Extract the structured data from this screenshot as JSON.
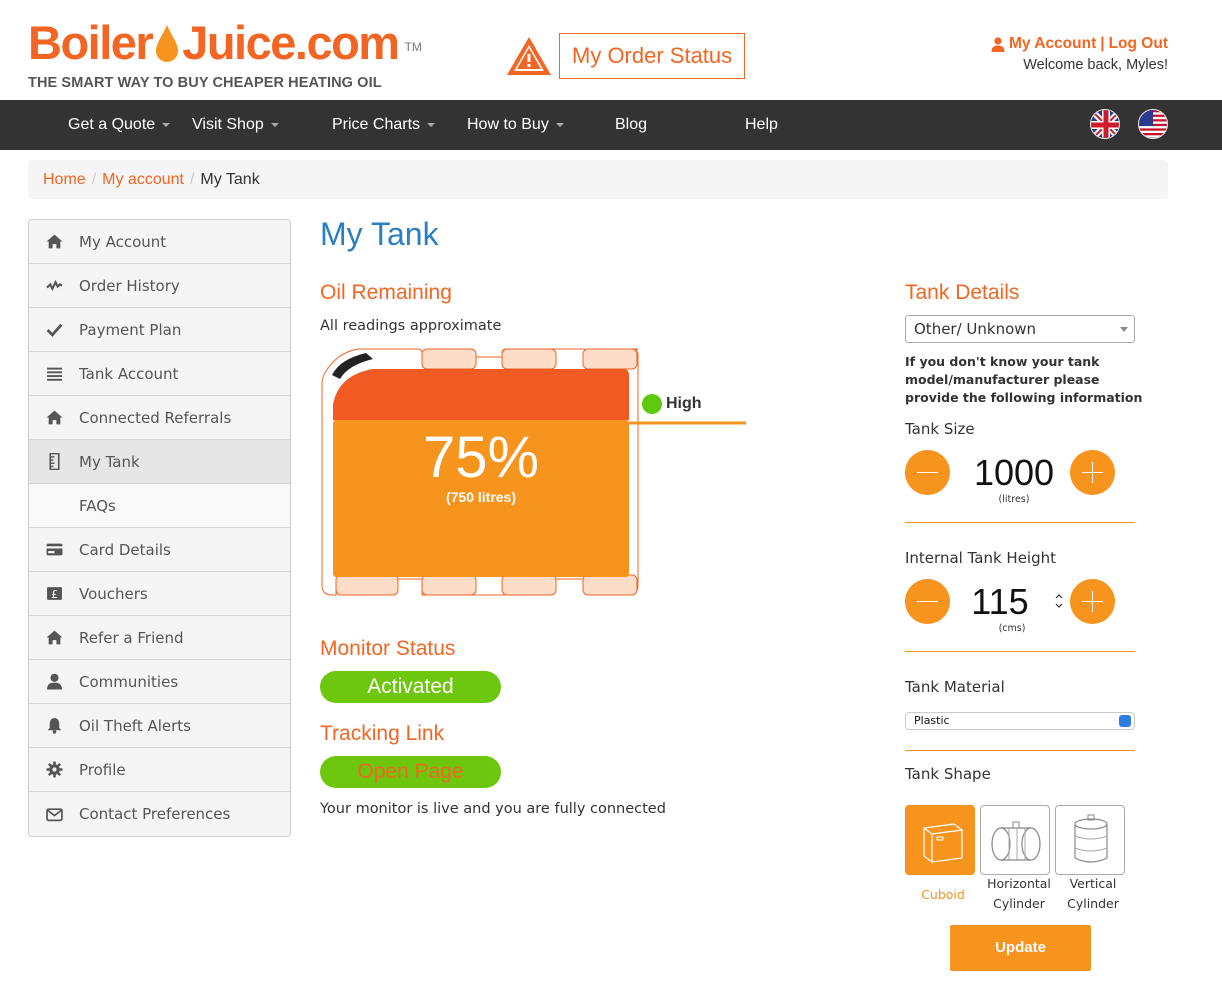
{
  "header": {
    "logo_part1": "Boiler",
    "logo_part2": "Juice.com",
    "logo_tm": "TM",
    "tagline": "THE SMART WAY TO BUY CHEAPER HEATING OIL",
    "order_status": "My Order Status",
    "my_account": "My Account",
    "separator": "|",
    "log_out": "Log Out",
    "welcome": "Welcome back, Myles!"
  },
  "nav": {
    "items": [
      "Get a Quote",
      "Visit Shop",
      "Price Charts",
      "How to Buy",
      "Blog",
      "Help"
    ]
  },
  "breadcrumb": [
    "Home",
    "My account",
    "My Tank"
  ],
  "sidebar": {
    "items": [
      {
        "label": "My Account",
        "icon": "home-icon"
      },
      {
        "label": "Order History",
        "icon": "activity-icon"
      },
      {
        "label": "Payment Plan",
        "icon": "check-icon"
      },
      {
        "label": "Tank Account",
        "icon": "list-icon"
      },
      {
        "label": "Connected Referrals",
        "icon": "home-icon"
      },
      {
        "label": "My Tank",
        "icon": "ruler-icon"
      },
      {
        "label": "FAQs",
        "icon": ""
      },
      {
        "label": "Card Details",
        "icon": "credit-card-icon"
      },
      {
        "label": "Vouchers",
        "icon": "pound-icon"
      },
      {
        "label": "Refer a Friend",
        "icon": "home-icon"
      },
      {
        "label": "Communities",
        "icon": "user-icon"
      },
      {
        "label": "Oil Theft Alerts",
        "icon": "bell-icon"
      },
      {
        "label": "Profile",
        "icon": "gear-icon"
      },
      {
        "label": "Contact Preferences",
        "icon": "envelope-icon"
      }
    ]
  },
  "main": {
    "title": "My Tank",
    "oil_remaining_heading": "Oil Remaining",
    "approx_note": "All readings approximate",
    "fill_percent": "75%",
    "fill_litres": "(750 litres)",
    "fill_fraction": 0.75,
    "level_label": "High",
    "monitor_heading": "Monitor Status",
    "monitor_status": "Activated",
    "tracking_heading": "Tracking Link",
    "tracking_button": "Open Page",
    "live_text": "Your monitor is live and you are fully connected"
  },
  "tank_details": {
    "heading": "Tank Details",
    "model_select": "Other/ Unknown",
    "note": "If you don't know your tank model/manufacturer please provide the following information",
    "size_label": "Tank Size",
    "size_value": "1000",
    "size_unit": "(litres)",
    "height_label": "Internal Tank Height",
    "height_value": "115",
    "height_unit": "(cms)",
    "material_label": "Tank Material",
    "material_value": "Plastic",
    "shape_label": "Tank Shape",
    "shapes": [
      "Cuboid",
      "Horizontal Cylinder",
      "Vertical Cylinder"
    ],
    "shape_selected": "Cuboid",
    "update_button": "Update"
  },
  "colors": {
    "brand_orange": "#f26522",
    "fill_orange": "#f7941d",
    "status_green": "#6cc70e",
    "title_blue": "#2a7fc1",
    "nav_bg": "#333333"
  }
}
